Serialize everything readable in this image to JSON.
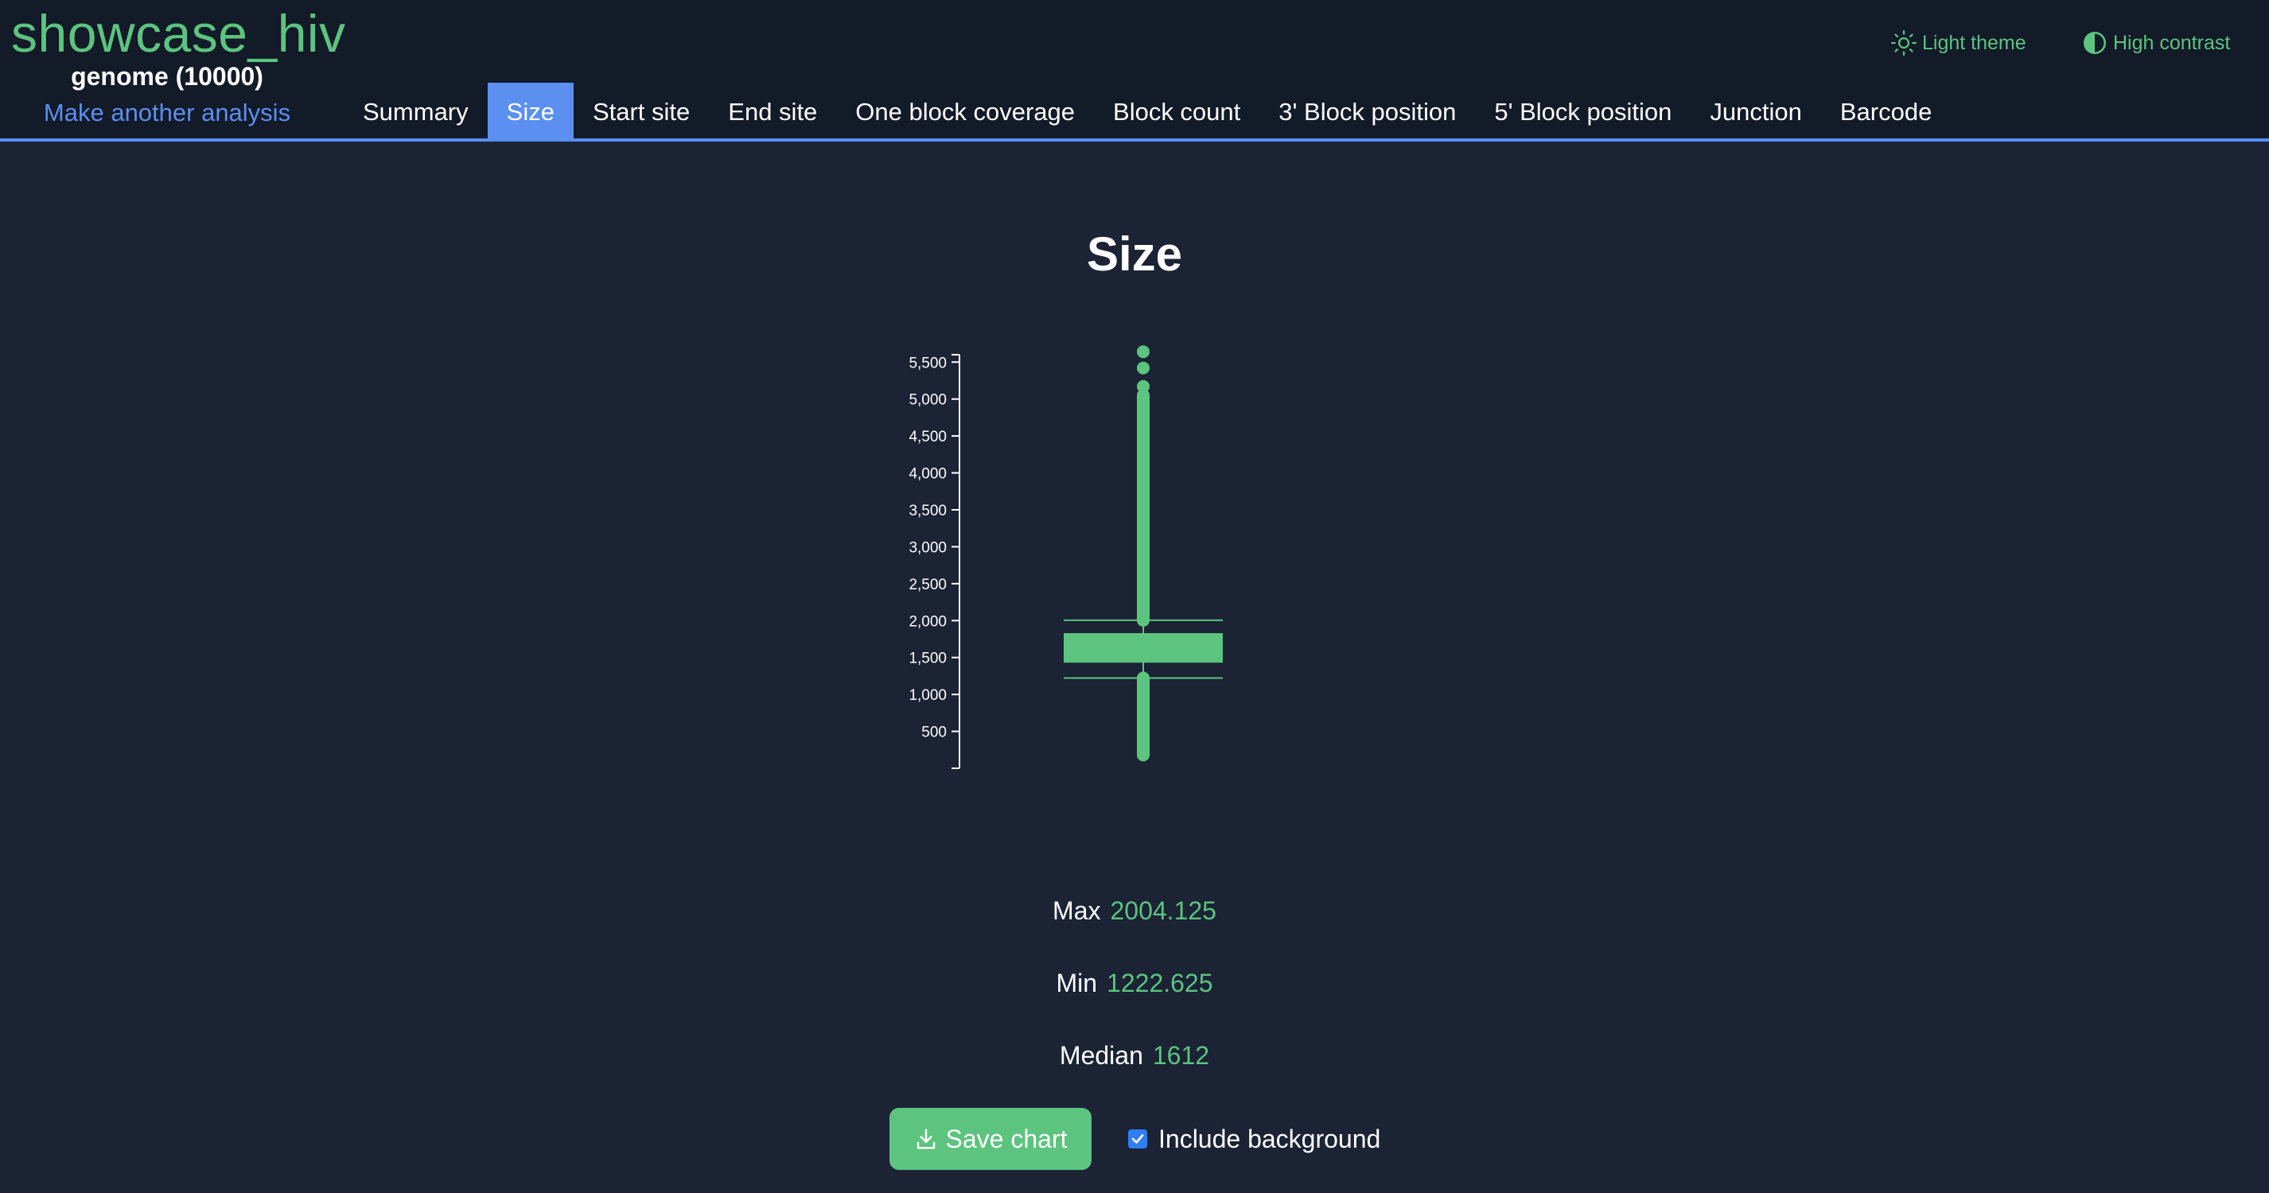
{
  "app": {
    "title": "showcase_hiv",
    "subtitle": "genome (10000)",
    "another_analysis": "Make another analysis"
  },
  "tabs": [
    {
      "label": "Summary"
    },
    {
      "label": "Size",
      "active": true
    },
    {
      "label": "Start site"
    },
    {
      "label": "End site"
    },
    {
      "label": "One block coverage"
    },
    {
      "label": "Block count"
    },
    {
      "label": "3' Block position"
    },
    {
      "label": "5' Block position"
    },
    {
      "label": "Junction"
    },
    {
      "label": "Barcode"
    }
  ],
  "top_actions": {
    "light_theme": "Light theme",
    "high_contrast": "High contrast"
  },
  "page": {
    "title": "Size"
  },
  "chart_data": {
    "type": "boxplot",
    "title": "",
    "xlabel": "",
    "ylabel": "",
    "ylim": [
      0,
      5600
    ],
    "ticks": [
      500,
      1000,
      1500,
      2000,
      2500,
      3000,
      3500,
      4000,
      4500,
      5000,
      5500
    ],
    "tick_labels": [
      "500",
      "1,000",
      "1,500",
      "2,000",
      "2,500",
      "3,000",
      "3,500",
      "4,000",
      "4,500",
      "5,000",
      "5,500"
    ],
    "box": {
      "q1": 1430,
      "median": 1612,
      "q3": 1830,
      "whisker_low": 1222.625,
      "whisker_high": 2004.125
    },
    "outliers_high_range": [
      2004,
      5050
    ],
    "outliers_high_points": [
      5170,
      5420,
      5640
    ],
    "outliers_low_range": [
      180,
      1222
    ],
    "color": "#5cc47e"
  },
  "stats": {
    "max_label": "Max",
    "max_value": "2004.125",
    "min_label": "Min",
    "min_value": "1222.625",
    "median_label": "Median",
    "median_value": "1612"
  },
  "actions": {
    "save_chart": "Save chart",
    "include_background": "Include background",
    "include_background_checked": true
  },
  "colors": {
    "accent": "#5b8ff0",
    "green": "#5cc47e",
    "background": "#1b2335",
    "header": "#131a28"
  }
}
